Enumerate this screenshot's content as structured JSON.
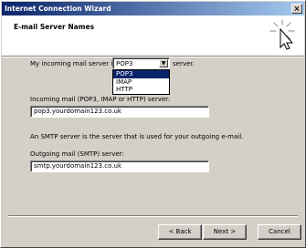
{
  "window": {
    "title": "Internet Connection Wizard",
    "close_label": "×"
  },
  "header": {
    "title": "E-mail Server Names",
    "icon": "wizard-pointer-icon"
  },
  "incoming_type": {
    "label": "My incoming mail server is a",
    "selected": "POP3",
    "suffix": "server.",
    "options": [
      "POP3",
      "IMAP",
      "HTTP"
    ]
  },
  "incoming_server": {
    "label": "Incoming mail (POP3, IMAP or HTTP) server:",
    "value": "pop3.yourdomain123.co.uk"
  },
  "smtp_note": "An SMTP server is the server that is used for your outgoing e-mail.",
  "outgoing_server": {
    "label": "Outgoing mail (SMTP) server:",
    "value": "smtp.yourdomain123.co.uk"
  },
  "buttons": {
    "back": "< Back",
    "next": "Next >",
    "cancel": "Cancel"
  },
  "colors": {
    "titlebar_start": "#0a246a",
    "titlebar_end": "#a6caf0",
    "face": "#d4d0c8",
    "selection": "#0a246a"
  }
}
